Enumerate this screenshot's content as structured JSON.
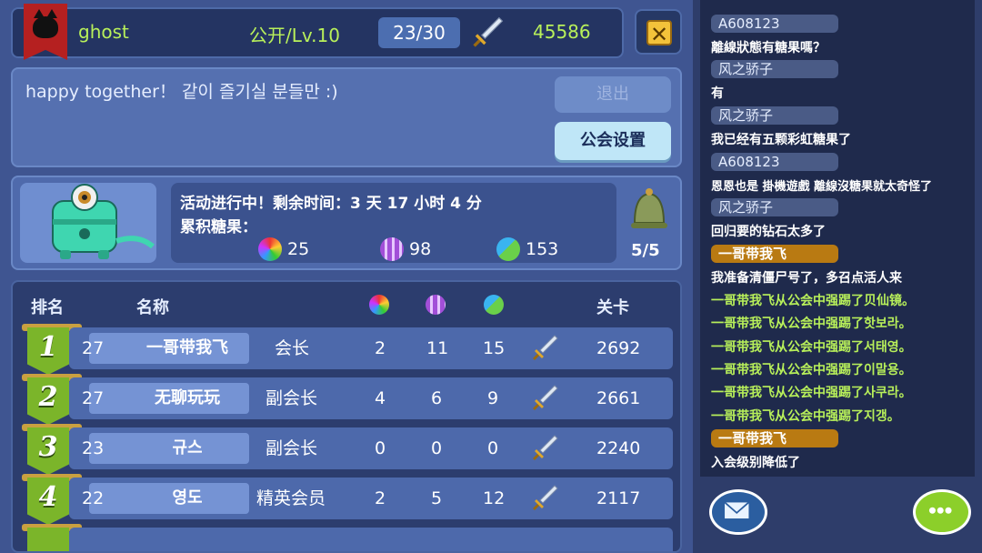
{
  "header": {
    "player_name": "ghost",
    "level": "公开/Lv.10",
    "members": "23/30",
    "score": "45586"
  },
  "notice": {
    "text": "happy together！ 같이 즐기실 분들만 :)",
    "exit_label": "退出",
    "settings_label": "公会设置"
  },
  "event": {
    "line1": "活动进行中！剩余时间：3 天 17 小时 4 分",
    "line2": "累积糖果：",
    "candies": [
      "25",
      "98",
      "153"
    ],
    "bell_count": "5/5"
  },
  "table": {
    "headers": {
      "rank": "排名",
      "name": "名称",
      "stage": "关卡"
    },
    "rows": [
      {
        "rank": "1",
        "level": "27",
        "name": "一哥带我飞",
        "role": "会长",
        "c1": "2",
        "c2": "11",
        "c3": "15",
        "stage": "2692"
      },
      {
        "rank": "2",
        "level": "27",
        "name": "无聊玩玩",
        "role": "副会长",
        "c1": "4",
        "c2": "6",
        "c3": "9",
        "stage": "2661"
      },
      {
        "rank": "3",
        "level": "23",
        "name": "규스",
        "role": "副会长",
        "c1": "0",
        "c2": "0",
        "c3": "0",
        "stage": "2240"
      },
      {
        "rank": "4",
        "level": "22",
        "name": "영도",
        "role": "精英会员",
        "c1": "2",
        "c2": "5",
        "c3": "12",
        "stage": "2117"
      }
    ]
  },
  "chat": {
    "messages": [
      {
        "kind": "chip-gray",
        "text": "A608123"
      },
      {
        "kind": "white",
        "text": "離線狀態有糖果嗎？"
      },
      {
        "kind": "chip-gray",
        "text": "风之骄子"
      },
      {
        "kind": "white",
        "text": "有"
      },
      {
        "kind": "chip-gray",
        "text": "风之骄子"
      },
      {
        "kind": "white",
        "text": "我已经有五颗彩虹糖果了"
      },
      {
        "kind": "chip-gray",
        "text": "A608123"
      },
      {
        "kind": "white",
        "text": "恩恩也是 掛機遊戲 離線沒糖果就太奇怪了"
      },
      {
        "kind": "chip-gray",
        "text": "风之骄子"
      },
      {
        "kind": "white",
        "text": "回归要的钻石太多了"
      },
      {
        "kind": "chip-gold",
        "text": "一哥带我飞"
      },
      {
        "kind": "white",
        "text": "我准备清僵尸号了，多召点活人来"
      },
      {
        "kind": "green",
        "text": "一哥带我飞从公会中强踢了贝仙镜。"
      },
      {
        "kind": "green",
        "text": "一哥带我飞从公会中强踢了핫보라。"
      },
      {
        "kind": "green",
        "text": "一哥带我飞从公会中强踢了서태영。"
      },
      {
        "kind": "green",
        "text": "一哥带我飞从公会中强踢了이말용。"
      },
      {
        "kind": "green",
        "text": "一哥带我飞从公会中强踢了사쿠라。"
      },
      {
        "kind": "green",
        "text": "一哥带我飞从公会中强踢了지갱。"
      },
      {
        "kind": "chip-gold",
        "text": "一哥带我飞"
      },
      {
        "kind": "white",
        "text": "入会级别降低了"
      }
    ]
  },
  "colors": {
    "accent_green": "#b8f05a",
    "gold": "#b97a12",
    "panel": "#3f5591"
  }
}
